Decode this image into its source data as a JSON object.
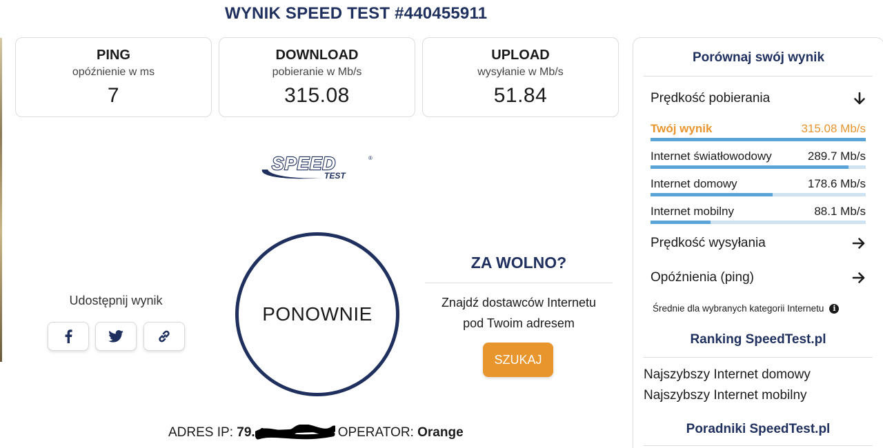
{
  "title": "WYNIK SPEED TEST #440455911",
  "cards": [
    {
      "key": "PING",
      "sub": "opóźnienie w ms",
      "value": "7"
    },
    {
      "key": "DOWNLOAD",
      "sub": "pobieranie w Mb/s",
      "value": "315.08"
    },
    {
      "key": "UPLOAD",
      "sub": "wysyłanie w Mb/s",
      "value": "51.84"
    }
  ],
  "logo": {
    "text": "SPEED",
    "sub": "TEST",
    "mark": "®"
  },
  "share": {
    "label": "Udostępnij wynik",
    "icons": [
      "facebook-icon",
      "twitter-icon",
      "link-icon"
    ]
  },
  "restart_label": "PONOWNIE",
  "slow": {
    "title": "ZA WOLNO?",
    "text_line1": "Znajdź dostawców Internetu",
    "text_line2": "pod Twoim adresem",
    "button": "SZUKAJ"
  },
  "ip": {
    "label": "ADRES IP:",
    "value_prefix": "79.",
    "operator_label": "OPERATOR:",
    "operator": "Orange"
  },
  "panel": {
    "title": "Porównaj swój wynik",
    "download_head": "Prędkość pobierania",
    "rows": [
      {
        "label": "Twój wynik",
        "value": "315.08 Mb/s",
        "fill": 1.0,
        "mine": true
      },
      {
        "label": "Internet światłowodowy",
        "value": "289.7 Mb/s",
        "fill": 0.919
      },
      {
        "label": "Internet domowy",
        "value": "178.6 Mb/s",
        "fill": 0.567
      },
      {
        "label": "Internet mobilny",
        "value": "88.1 Mb/s",
        "fill": 0.28
      }
    ],
    "upload_head": "Prędkość wysyłania",
    "ping_head": "Opóźnienia (ping)",
    "avg_note": "Średnie dla wybranych kategorii Internetu",
    "ranking_title": "Ranking SpeedTest.pl",
    "ranking_links": [
      "Najszybszy Internet domowy",
      "Najszybszy Internet mobilny"
    ],
    "guides_title": "Poradniki SpeedTest.pl"
  },
  "colors": {
    "navy": "#1f2f5e",
    "orange": "#e8952e",
    "bar": "#5aa3d6",
    "bar_track": "#cfe2f1"
  }
}
